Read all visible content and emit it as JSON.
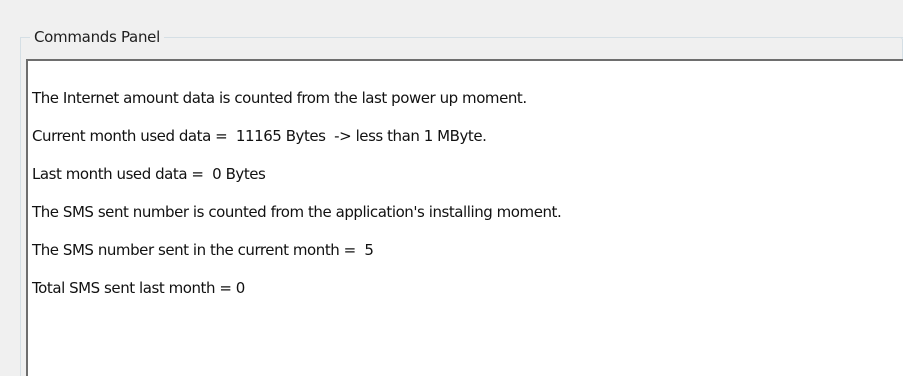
{
  "panel": {
    "title": "Commands Panel",
    "lines": [
      "The Internet amount data is counted from the last power up moment.",
      "Current month used data =  11165 Bytes  -> less than 1 MByte.",
      "Last month used data =  0 Bytes",
      "The SMS sent number is counted from the application's installing moment.",
      "The SMS number sent in the current month =  5",
      "Total SMS sent last month = 0"
    ]
  },
  "colors": {
    "window_background": "#f0f0f0",
    "text_area_background": "#ffffff",
    "text_area_border": "#6e6e6e",
    "groupbox_border": "#d5dfe5",
    "text": "#111111"
  }
}
